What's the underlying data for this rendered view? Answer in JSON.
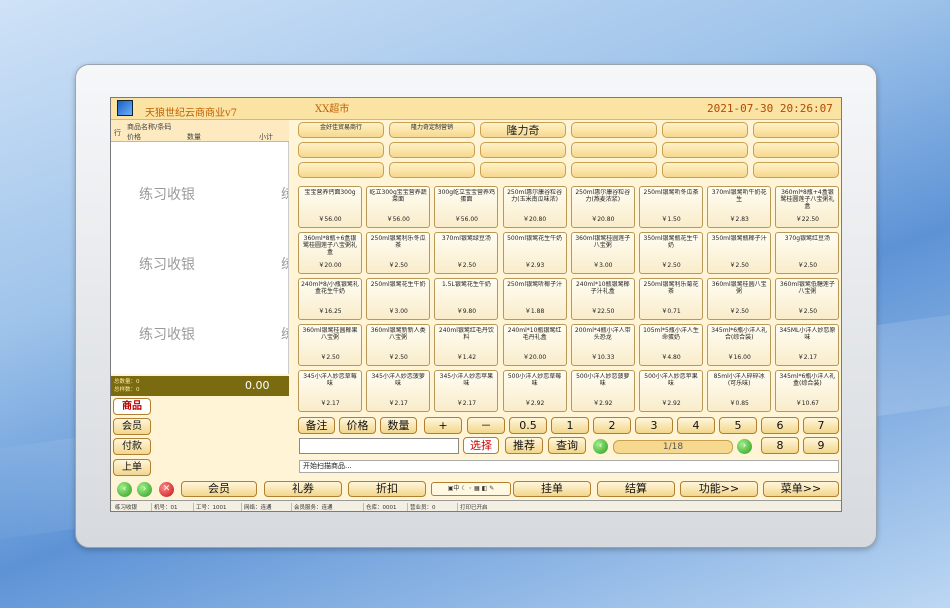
{
  "header": {
    "app_title": "天狼世纪云商商业v7",
    "store_name": "XX超市",
    "datetime": "2021-07-30  20:26:07"
  },
  "cart": {
    "col_row": "行",
    "col_name": "商品名称/条码",
    "col_price": "价格",
    "col_qty": "数量",
    "col_subtotal": "小计",
    "watermark": "练习收银",
    "watermark_cut": "练",
    "total_qty": "总数量：0",
    "total_items": "总样数：0",
    "total_amount": "0.00"
  },
  "side_buttons": [
    "商品",
    "会员",
    "付款",
    "上单"
  ],
  "categories": [
    [
      "金好佳贸易商行",
      "隆力奇定制营销",
      "隆力奇",
      "",
      "",
      ""
    ],
    [
      "",
      "",
      "",
      "",
      "",
      ""
    ],
    [
      "",
      "",
      "",
      "",
      "",
      ""
    ]
  ],
  "products": [
    {
      "name": "宝宝营养钙面300g",
      "price": "￥56.00"
    },
    {
      "name": "屹立300g宝宝营养蔬菜面",
      "price": "￥56.00"
    },
    {
      "name": "300g屹立宝宝营养鸡蛋面",
      "price": "￥56.00"
    },
    {
      "name": "250ml惠尔康谷粒谷力(玉米南瓜味浓)",
      "price": "￥20.80"
    },
    {
      "name": "250ml惠尔康谷粒谷力(燕麦浓浆)",
      "price": "￥20.80"
    },
    {
      "name": "250ml银鹭听冬瓜茶",
      "price": "￥1.50"
    },
    {
      "name": "370ml银鹭听牛奶花生",
      "price": "￥2.83"
    },
    {
      "name": "360ml*8瓶+4盒银鹭桂圆莲子八宝粥礼盒",
      "price": "￥22.50"
    },
    {
      "name": "360ml*8瓶+6盒银鹭桂圆莲子八宝粥礼盒",
      "price": "￥20.00"
    },
    {
      "name": "250ml银鹭利乐冬瓜茶",
      "price": "￥2.50"
    },
    {
      "name": "370ml银鹭绿豆汤",
      "price": "￥2.50"
    },
    {
      "name": "500ml银鹭花生牛奶",
      "price": "￥2.93"
    },
    {
      "name": "360ml银鹭桂圆莲子八宝粥",
      "price": "￥3.00"
    },
    {
      "name": "350ml银鹭瓶花生牛奶",
      "price": "￥2.50"
    },
    {
      "name": "350ml银鹭瓶椰子汁",
      "price": "￥2.50"
    },
    {
      "name": "370g银鹭红豆汤",
      "price": "￥2.50"
    },
    {
      "name": "240ml*8/小瓶银鹭礼盒花生牛奶",
      "price": "￥16.25"
    },
    {
      "name": "250ml银鹭花生牛奶",
      "price": "￥3.00"
    },
    {
      "name": "1.5L银鹭花生牛奶",
      "price": "￥9.80"
    },
    {
      "name": "250ml银鹭听椰子汁",
      "price": "￥1.88"
    },
    {
      "name": "240ml*10瓶银鹭椰子汁礼盒",
      "price": "￥22.50"
    },
    {
      "name": "250ml银鹭利乐菊花茶",
      "price": "￥0.71"
    },
    {
      "name": "360ml银鹭桂圆八宝粥",
      "price": "￥2.50"
    },
    {
      "name": "360ml银鹭低糖莲子八宝粥",
      "price": "￥2.50"
    },
    {
      "name": "360ml银鹭桂圆椰果八宝粥",
      "price": "￥2.50"
    },
    {
      "name": "360ml银鹭新新人类八宝粥",
      "price": "￥2.50"
    },
    {
      "name": "240ml银鹭红毛丹饮料",
      "price": "￥1.42"
    },
    {
      "name": "240ml*10瓶银鹭红毛丹礼盒",
      "price": "￥20.00"
    },
    {
      "name": "200ml*4瓶小洋人带头恐龙",
      "price": "￥10.33"
    },
    {
      "name": "105ml*5瓶小洋人生命蛋奶",
      "price": "￥4.80"
    },
    {
      "name": "345ml*6瓶小洋人礼合(综合装)",
      "price": "￥16.00"
    },
    {
      "name": "345ML小洋人妙恋原味",
      "price": "￥2.17"
    },
    {
      "name": "345小洋人妙恋草莓味",
      "price": "￥2.17"
    },
    {
      "name": "345小洋人妙恋菠萝味",
      "price": "￥2.17"
    },
    {
      "name": "345小洋人妙恋苹果味",
      "price": "￥2.17"
    },
    {
      "name": "500小洋人妙恋草莓味",
      "price": "￥2.92"
    },
    {
      "name": "500小洋人妙恋菠萝味",
      "price": "￥2.92"
    },
    {
      "name": "500小洋人妙恋苹果味",
      "price": "￥2.92"
    },
    {
      "name": "85ml小洋人碎碎冰(可乐味)",
      "price": "￥0.85"
    },
    {
      "name": "345ml*6瓶小洋人礼盒(综合装)",
      "price": "￥10.67"
    }
  ],
  "keypad": {
    "note": "备注",
    "price": "价格",
    "qty": "数量",
    "plus": "+",
    "minus": "－",
    "half": "0.5",
    "digits": [
      "1",
      "2",
      "3",
      "4",
      "5",
      "6",
      "7",
      "8",
      "9"
    ]
  },
  "search": {
    "select": "选择",
    "recommend": "推荐",
    "query": "查询",
    "page": "1/18"
  },
  "status_line": "开始扫描商品...",
  "function_bar": {
    "member": "会员",
    "coupon": "礼券",
    "discount": "折扣",
    "mini_icons": "▣中 ☾ ◦ ▦ ◧ ✎",
    "hang": "挂单",
    "checkout": "结算",
    "func": "功能>>",
    "menu": "菜单>>"
  },
  "statusbar": [
    "练习收银",
    "机号：01",
    "工号：1001",
    "网络：连通",
    "会员服务：连通",
    "仓库：0001",
    "营业员：0",
    "打印已开启"
  ]
}
